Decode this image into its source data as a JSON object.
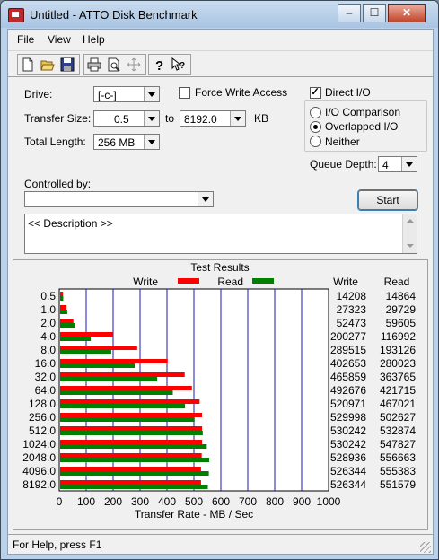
{
  "window": {
    "title": "Untitled - ATTO Disk Benchmark",
    "minimize": "–",
    "maximize": "☐",
    "close": "✕"
  },
  "menu": [
    "File",
    "View",
    "Help"
  ],
  "toolbar": [
    "new-icon",
    "open-icon",
    "save-icon",
    "print-icon",
    "print-preview-icon",
    "move-icon",
    "help-icon",
    "context-help-icon"
  ],
  "settings": {
    "drive_label": "Drive:",
    "drive_value": "[-c-]",
    "force_write_label": "Force Write Access",
    "force_write_checked": false,
    "direct_io_label": "Direct I/O",
    "direct_io_checked": true,
    "transfer_size_label": "Transfer Size:",
    "transfer_from": "0.5",
    "to_label": "to",
    "transfer_to": "8192.0",
    "kb_label": "KB",
    "total_length_label": "Total Length:",
    "total_length_value": "256 MB",
    "io_comparison_label": "I/O Comparison",
    "overlapped_io_label": "Overlapped I/O",
    "neither_label": "Neither",
    "io_mode_selected": "Overlapped I/O",
    "queue_depth_label": "Queue Depth:",
    "queue_depth_value": "4",
    "controlled_by_label": "Controlled by:",
    "controlled_by_value": "",
    "start_label": "Start",
    "description": "<< Description >>"
  },
  "results": {
    "title": "Test Results",
    "write_legend": "Write",
    "read_legend": "Read",
    "write_col": "Write",
    "read_col": "Read",
    "write_color": "#ff0000",
    "read_color": "#008000",
    "grid_color": "#1a1ab0"
  },
  "chart_data": {
    "type": "bar",
    "title": "Test Results",
    "xlabel": "Transfer Rate - MB / Sec",
    "xlim": [
      0,
      1000
    ],
    "xticks": [
      "0",
      "100",
      "200",
      "300",
      "400",
      "500",
      "600",
      "700",
      "800",
      "900",
      "1000"
    ],
    "categories": [
      "0.5",
      "1.0",
      "2.0",
      "4.0",
      "8.0",
      "16.0",
      "32.0",
      "64.0",
      "128.0",
      "256.0",
      "512.0",
      "1024.0",
      "2048.0",
      "4096.0",
      "8192.0"
    ],
    "series": [
      {
        "name": "Write",
        "values": [
          14208,
          27323,
          52473,
          200277,
          289515,
          402653,
          465859,
          492676,
          520971,
          529998,
          530242,
          530242,
          528936,
          526344,
          526344
        ]
      },
      {
        "name": "Read",
        "values": [
          14864,
          29729,
          59605,
          116992,
          193126,
          280023,
          363765,
          421715,
          467021,
          502627,
          532874,
          547827,
          556663,
          555383,
          551579
        ]
      }
    ]
  },
  "status": {
    "text": "For Help, press F1"
  }
}
